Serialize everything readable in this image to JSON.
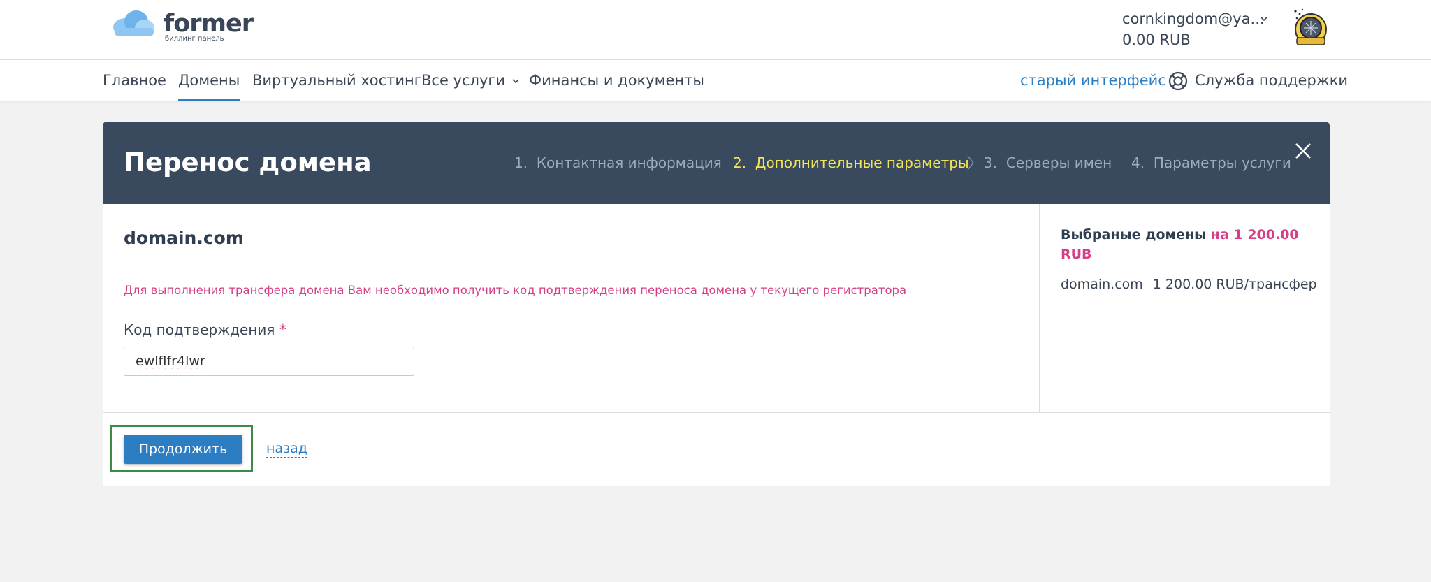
{
  "header": {
    "logo_name": "former",
    "logo_sub": "биллинг панель",
    "account_email": "cornkingdom@ya...",
    "account_balance": "0.00 RUB",
    "icons": [
      "cloud-logo-icon",
      "chevron-down-icon",
      "avatar-icon"
    ]
  },
  "nav": {
    "items": [
      "Главное",
      "Домены",
      "Виртуальный хостинг",
      "Все услуги",
      "Финансы и документы"
    ],
    "active": "Домены",
    "old_interface": "старый интерфейс",
    "support": "Служба поддержки",
    "icons": [
      "chevron-down-icon",
      "lifebuoy-icon"
    ]
  },
  "modal": {
    "title": "Перенос домена",
    "steps": [
      {
        "num": "1.",
        "label": "Контактная информация"
      },
      {
        "num": "2.",
        "label": "Дополнительные параметры"
      },
      {
        "num": "3.",
        "label": "Серверы имен"
      },
      {
        "num": "4.",
        "label": "Параметры услуги"
      }
    ],
    "active_step": 2,
    "close_icon": "close-icon"
  },
  "form": {
    "domain": "domain.com",
    "notice": "Для выполнения трансфера домена Вам необходимо получить код подтверждения переноса домена у текущего регистратора",
    "code_label": "Код подтверждения",
    "required_mark": "*",
    "code_value": "ewlflfr4lwr"
  },
  "summary": {
    "title": "Выбраные домены",
    "price": "на 1 200.00 RUB",
    "row_domain": "domain.com",
    "row_price": "1 200.00 RUB/трансфер"
  },
  "actions": {
    "continue": "Продолжить",
    "back": "назад"
  },
  "colors": {
    "accent": "#2d7dc3",
    "header_dark": "#394a5e",
    "active_step": "#f1e35a",
    "pink": "#d63e86",
    "highlight_frame": "#3b8a47"
  }
}
